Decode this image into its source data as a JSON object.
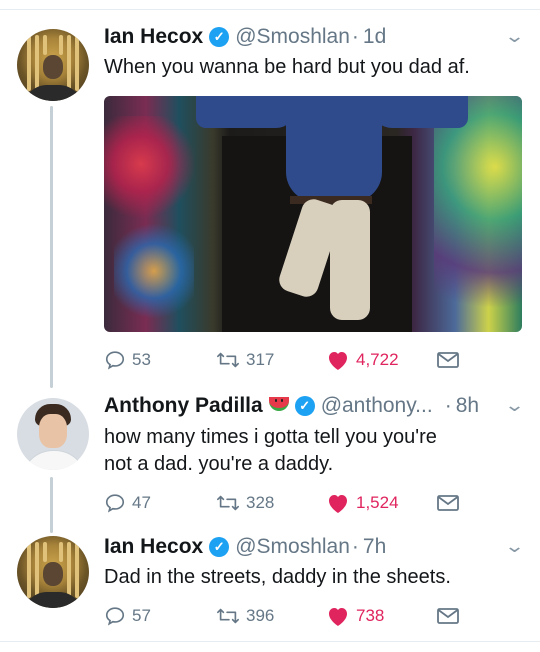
{
  "tweets": [
    {
      "name": "Ian Hecox",
      "handle": "@Smoshlan",
      "time": "1d",
      "text": "When you wanna be hard but you dad af.",
      "replies": "53",
      "retweets": "317",
      "likes": "4,722",
      "has_media": true
    },
    {
      "name": "Anthony Padilla",
      "handle": "@anthony...",
      "time": "8h",
      "text_lines": [
        "how many times i gotta tell you you're",
        "not a dad. you're a daddy."
      ],
      "replies": "47",
      "retweets": "328",
      "likes": "1,524"
    },
    {
      "name": "Ian Hecox",
      "handle": "@Smoshlan",
      "time": "7h",
      "text": "Dad in the streets, daddy in the sheets.",
      "replies": "57",
      "retweets": "396",
      "likes": "738"
    }
  ],
  "icons": {
    "verified": "verified-badge-icon",
    "reply": "reply-icon",
    "retweet": "retweet-icon",
    "like": "heart-icon",
    "message": "direct-message-icon",
    "more": "chevron-down-icon",
    "emoji": "watermelon-emoji-icon"
  },
  "colors": {
    "verified": "#1da1f2",
    "like_active": "#e0245e",
    "muted": "#657786",
    "thread_line": "#c4cfd6"
  }
}
